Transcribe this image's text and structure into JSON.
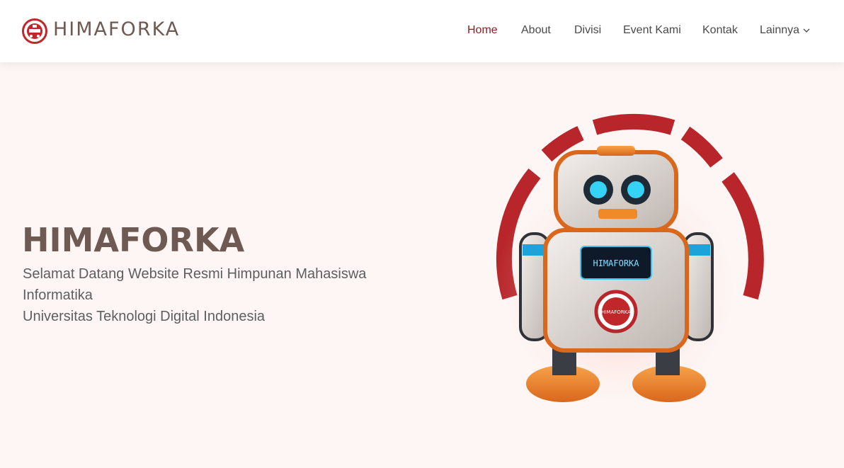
{
  "header": {
    "brand": "HIMAFORKA",
    "nav": [
      {
        "label": "Home",
        "active": true
      },
      {
        "label": "About"
      },
      {
        "label": "Divisi"
      },
      {
        "label": "Event Kami"
      },
      {
        "label": "Kontak"
      },
      {
        "label": "Lainnya"
      }
    ]
  },
  "hero": {
    "title": "HIMAFORKA",
    "subtitle_lines": [
      "Selamat Datang Website Resmi Himpunan Mahasiswa",
      "Informatika",
      "Universitas Teknologi Digital Indonesia"
    ],
    "robot_screen_text": "HIMAFORKA",
    "robot_badge_text": "HIMAFORKA"
  },
  "colors": {
    "accent": "#8b1e1e",
    "brand_text": "#6e5a52",
    "background": "#fdf6f4"
  }
}
